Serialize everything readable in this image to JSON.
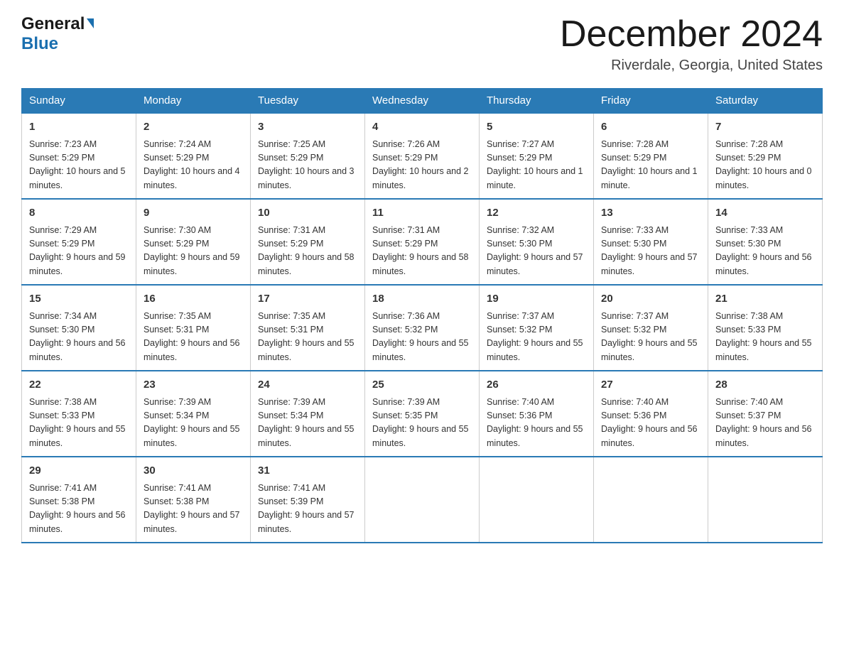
{
  "header": {
    "logo_general": "General",
    "logo_blue": "Blue",
    "month_title": "December 2024",
    "location": "Riverdale, Georgia, United States"
  },
  "days_of_week": [
    "Sunday",
    "Monday",
    "Tuesday",
    "Wednesday",
    "Thursday",
    "Friday",
    "Saturday"
  ],
  "weeks": [
    [
      {
        "day": "1",
        "sunrise": "7:23 AM",
        "sunset": "5:29 PM",
        "daylight": "10 hours and 5 minutes."
      },
      {
        "day": "2",
        "sunrise": "7:24 AM",
        "sunset": "5:29 PM",
        "daylight": "10 hours and 4 minutes."
      },
      {
        "day": "3",
        "sunrise": "7:25 AM",
        "sunset": "5:29 PM",
        "daylight": "10 hours and 3 minutes."
      },
      {
        "day": "4",
        "sunrise": "7:26 AM",
        "sunset": "5:29 PM",
        "daylight": "10 hours and 2 minutes."
      },
      {
        "day": "5",
        "sunrise": "7:27 AM",
        "sunset": "5:29 PM",
        "daylight": "10 hours and 1 minute."
      },
      {
        "day": "6",
        "sunrise": "7:28 AM",
        "sunset": "5:29 PM",
        "daylight": "10 hours and 1 minute."
      },
      {
        "day": "7",
        "sunrise": "7:28 AM",
        "sunset": "5:29 PM",
        "daylight": "10 hours and 0 minutes."
      }
    ],
    [
      {
        "day": "8",
        "sunrise": "7:29 AM",
        "sunset": "5:29 PM",
        "daylight": "9 hours and 59 minutes."
      },
      {
        "day": "9",
        "sunrise": "7:30 AM",
        "sunset": "5:29 PM",
        "daylight": "9 hours and 59 minutes."
      },
      {
        "day": "10",
        "sunrise": "7:31 AM",
        "sunset": "5:29 PM",
        "daylight": "9 hours and 58 minutes."
      },
      {
        "day": "11",
        "sunrise": "7:31 AM",
        "sunset": "5:29 PM",
        "daylight": "9 hours and 58 minutes."
      },
      {
        "day": "12",
        "sunrise": "7:32 AM",
        "sunset": "5:30 PM",
        "daylight": "9 hours and 57 minutes."
      },
      {
        "day": "13",
        "sunrise": "7:33 AM",
        "sunset": "5:30 PM",
        "daylight": "9 hours and 57 minutes."
      },
      {
        "day": "14",
        "sunrise": "7:33 AM",
        "sunset": "5:30 PM",
        "daylight": "9 hours and 56 minutes."
      }
    ],
    [
      {
        "day": "15",
        "sunrise": "7:34 AM",
        "sunset": "5:30 PM",
        "daylight": "9 hours and 56 minutes."
      },
      {
        "day": "16",
        "sunrise": "7:35 AM",
        "sunset": "5:31 PM",
        "daylight": "9 hours and 56 minutes."
      },
      {
        "day": "17",
        "sunrise": "7:35 AM",
        "sunset": "5:31 PM",
        "daylight": "9 hours and 55 minutes."
      },
      {
        "day": "18",
        "sunrise": "7:36 AM",
        "sunset": "5:32 PM",
        "daylight": "9 hours and 55 minutes."
      },
      {
        "day": "19",
        "sunrise": "7:37 AM",
        "sunset": "5:32 PM",
        "daylight": "9 hours and 55 minutes."
      },
      {
        "day": "20",
        "sunrise": "7:37 AM",
        "sunset": "5:32 PM",
        "daylight": "9 hours and 55 minutes."
      },
      {
        "day": "21",
        "sunrise": "7:38 AM",
        "sunset": "5:33 PM",
        "daylight": "9 hours and 55 minutes."
      }
    ],
    [
      {
        "day": "22",
        "sunrise": "7:38 AM",
        "sunset": "5:33 PM",
        "daylight": "9 hours and 55 minutes."
      },
      {
        "day": "23",
        "sunrise": "7:39 AM",
        "sunset": "5:34 PM",
        "daylight": "9 hours and 55 minutes."
      },
      {
        "day": "24",
        "sunrise": "7:39 AM",
        "sunset": "5:34 PM",
        "daylight": "9 hours and 55 minutes."
      },
      {
        "day": "25",
        "sunrise": "7:39 AM",
        "sunset": "5:35 PM",
        "daylight": "9 hours and 55 minutes."
      },
      {
        "day": "26",
        "sunrise": "7:40 AM",
        "sunset": "5:36 PM",
        "daylight": "9 hours and 55 minutes."
      },
      {
        "day": "27",
        "sunrise": "7:40 AM",
        "sunset": "5:36 PM",
        "daylight": "9 hours and 56 minutes."
      },
      {
        "day": "28",
        "sunrise": "7:40 AM",
        "sunset": "5:37 PM",
        "daylight": "9 hours and 56 minutes."
      }
    ],
    [
      {
        "day": "29",
        "sunrise": "7:41 AM",
        "sunset": "5:38 PM",
        "daylight": "9 hours and 56 minutes."
      },
      {
        "day": "30",
        "sunrise": "7:41 AM",
        "sunset": "5:38 PM",
        "daylight": "9 hours and 57 minutes."
      },
      {
        "day": "31",
        "sunrise": "7:41 AM",
        "sunset": "5:39 PM",
        "daylight": "9 hours and 57 minutes."
      },
      null,
      null,
      null,
      null
    ]
  ],
  "labels": {
    "sunrise": "Sunrise:",
    "sunset": "Sunset:",
    "daylight": "Daylight:"
  }
}
